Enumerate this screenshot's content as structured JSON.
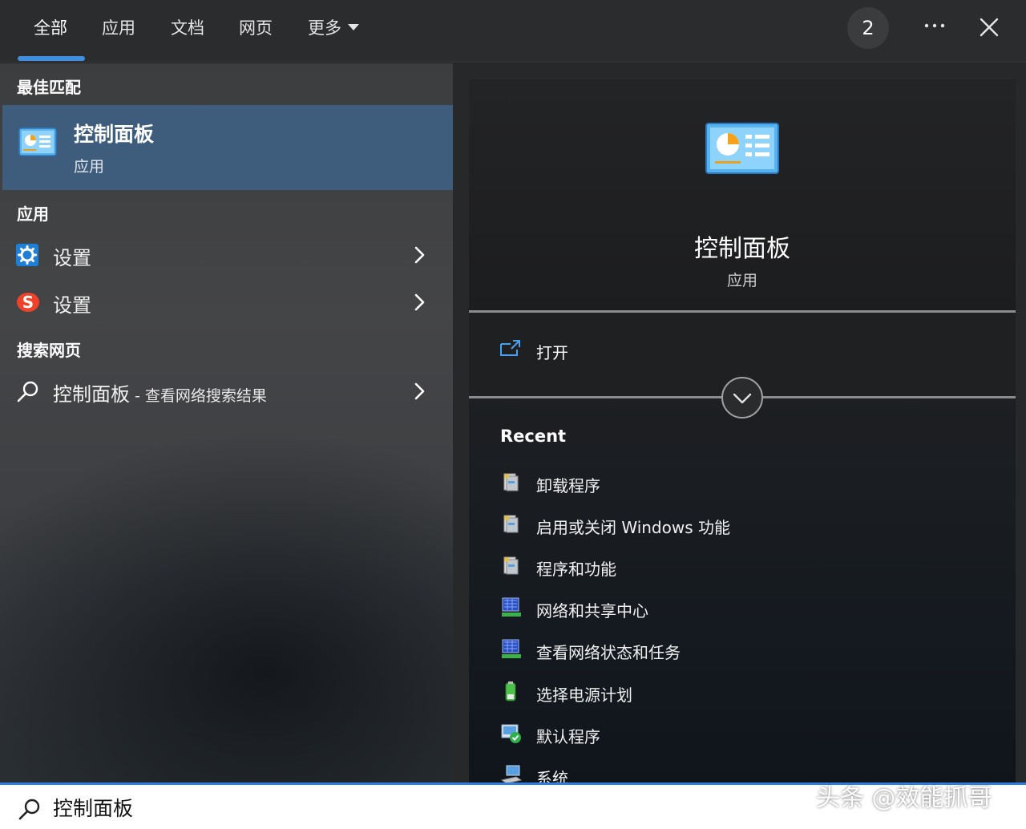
{
  "tabs": [
    {
      "label": "全部",
      "active": true
    },
    {
      "label": "应用"
    },
    {
      "label": "文档"
    },
    {
      "label": "网页"
    },
    {
      "label": "更多"
    }
  ],
  "header": {
    "badge_count": "2",
    "more_options_icon": "ellipsis-icon",
    "close_icon": "close-icon"
  },
  "left": {
    "best_match_header": "最佳匹配",
    "best_match": {
      "title": "控制面板",
      "subtitle": "应用",
      "icon": "control-panel-icon"
    },
    "apps_header": "应用",
    "apps": [
      {
        "label": "设置",
        "icon": "settings-gear-icon"
      },
      {
        "label": "设置",
        "icon": "sogou-s-icon"
      }
    ],
    "web_header": "搜索网页",
    "web_result": {
      "label": "控制面板",
      "suffix": " - 查看网络搜索结果",
      "icon": "search-icon"
    }
  },
  "right": {
    "app_title": "控制面板",
    "app_subtitle": "应用",
    "open_label": "打开",
    "recent_title": "Recent",
    "recent_items": [
      {
        "label": "卸载程序",
        "icon": "programs-icon"
      },
      {
        "label": "启用或关闭 Windows 功能",
        "icon": "programs-icon"
      },
      {
        "label": "程序和功能",
        "icon": "programs-icon"
      },
      {
        "label": "网络和共享中心",
        "icon": "network-icon"
      },
      {
        "label": "查看网络状态和任务",
        "icon": "network-icon"
      },
      {
        "label": "选择电源计划",
        "icon": "power-icon"
      },
      {
        "label": "默认程序",
        "icon": "default-programs-icon"
      },
      {
        "label": "系统",
        "icon": "system-icon"
      }
    ]
  },
  "search": {
    "value": "控制面板",
    "icon": "search-icon"
  },
  "watermark": "头条 @效能抓哥",
  "colors": {
    "accent": "#3f8ee0",
    "selection": "#3e5c7c",
    "searchbar_border": "#2f7fe0"
  }
}
